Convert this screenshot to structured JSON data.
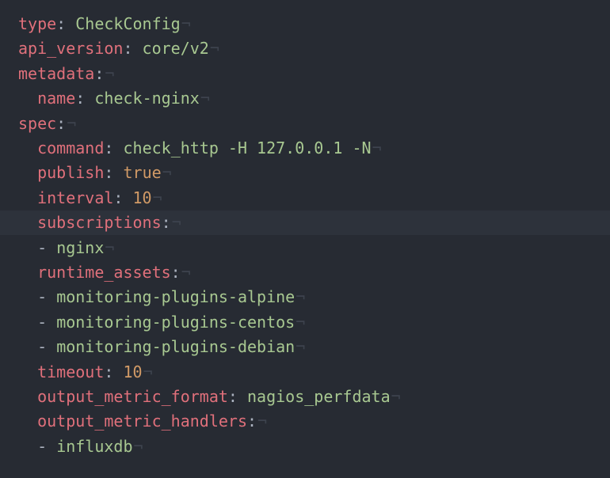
{
  "editor": {
    "partial_first_line": "---",
    "eol_marker": "¬",
    "lines": [
      {
        "indent": "",
        "key": "type",
        "sep": ": ",
        "value": "CheckConfig",
        "value_kind": "string"
      },
      {
        "indent": "",
        "key": "api_version",
        "sep": ": ",
        "value": "core/v2",
        "value_kind": "string"
      },
      {
        "indent": "",
        "key": "metadata",
        "sep": ":",
        "value": "",
        "value_kind": "none"
      },
      {
        "indent": "  ",
        "key": "name",
        "sep": ": ",
        "value": "check-nginx",
        "value_kind": "string"
      },
      {
        "indent": "",
        "key": "spec",
        "sep": ":",
        "value": "",
        "value_kind": "none"
      },
      {
        "indent": "  ",
        "key": "command",
        "sep": ": ",
        "value": "check_http -H 127.0.0.1 -N",
        "value_kind": "string"
      },
      {
        "indent": "  ",
        "key": "publish",
        "sep": ": ",
        "value": "true",
        "value_kind": "number"
      },
      {
        "indent": "  ",
        "key": "interval",
        "sep": ": ",
        "value": "10",
        "value_kind": "number"
      },
      {
        "indent": "  ",
        "key": "subscriptions",
        "sep": ":",
        "value": "",
        "value_kind": "none",
        "current": true
      },
      {
        "indent": "  ",
        "dash": "- ",
        "value": "nginx",
        "value_kind": "string"
      },
      {
        "indent": "  ",
        "key": "runtime_assets",
        "sep": ":",
        "value": "",
        "value_kind": "none"
      },
      {
        "indent": "  ",
        "dash": "- ",
        "value": "monitoring-plugins-alpine",
        "value_kind": "string"
      },
      {
        "indent": "  ",
        "dash": "- ",
        "value": "monitoring-plugins-centos",
        "value_kind": "string"
      },
      {
        "indent": "  ",
        "dash": "- ",
        "value": "monitoring-plugins-debian",
        "value_kind": "string"
      },
      {
        "indent": "  ",
        "key": "timeout",
        "sep": ": ",
        "value": "10",
        "value_kind": "number"
      },
      {
        "indent": "  ",
        "key": "output_metric_format",
        "sep": ": ",
        "value": "nagios_perfdata",
        "value_kind": "string"
      },
      {
        "indent": "  ",
        "key": "output_metric_handlers",
        "sep": ":",
        "value": "",
        "value_kind": "none"
      },
      {
        "indent": "  ",
        "dash": "- ",
        "value": "influxdb",
        "value_kind": "string"
      }
    ]
  },
  "colors": {
    "background": "#272b33",
    "current_line": "#2d323b",
    "key": "#e0707b",
    "string": "#a8c891",
    "number": "#d19a66",
    "punctuation": "#abb2bf",
    "invisible": "#3d434e"
  }
}
